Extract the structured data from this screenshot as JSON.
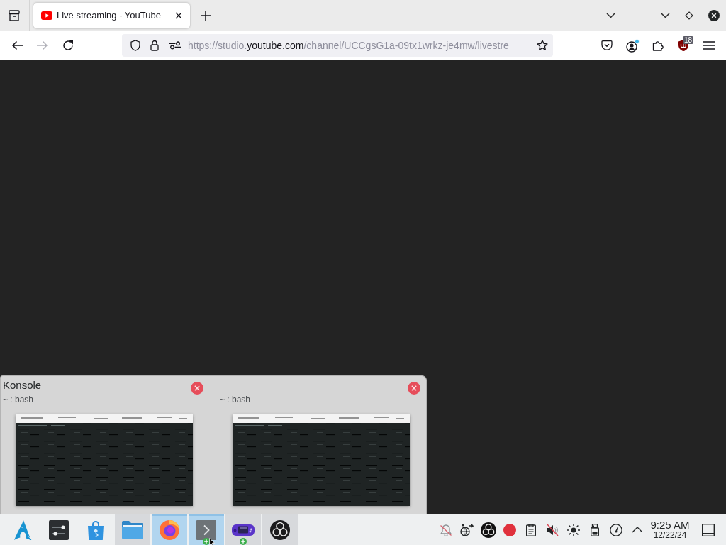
{
  "browser": {
    "tabs": [
      {
        "title": "Live streaming - YouTube",
        "selected": true
      }
    ],
    "navigation": [
      {
        "disabled": false
      },
      {
        "disabled": true
      },
      {
        "disabled": false
      }
    ],
    "address_bar": {
      "url_start": "https://studio.",
      "url_domain": "youtube.com",
      "url_end": "/channel/UCCgsG1a-09tx1wrkz-je4mw/livestre"
    },
    "extension_badge": "18"
  },
  "task_switcher": {
    "app_name": "Konsole",
    "windows": [
      {
        "title": "~ : bash"
      },
      {
        "title": "~ : bash"
      }
    ]
  },
  "taskbar": {
    "tasks": [
      {
        "running": false,
        "highlighted": false,
        "badge": false
      },
      {
        "running": false,
        "highlighted": false,
        "badge": false
      },
      {
        "running": true,
        "highlighted": false,
        "badge": false
      },
      {
        "running": true,
        "highlighted": true,
        "badge": false
      },
      {
        "running": true,
        "highlighted": true,
        "badge": true
      },
      {
        "running": true,
        "highlighted": false,
        "badge": true
      },
      {
        "running": true,
        "highlighted": false,
        "badge": false
      }
    ],
    "clock": {
      "time": "9:25 AM",
      "date": "12/22/24"
    }
  }
}
